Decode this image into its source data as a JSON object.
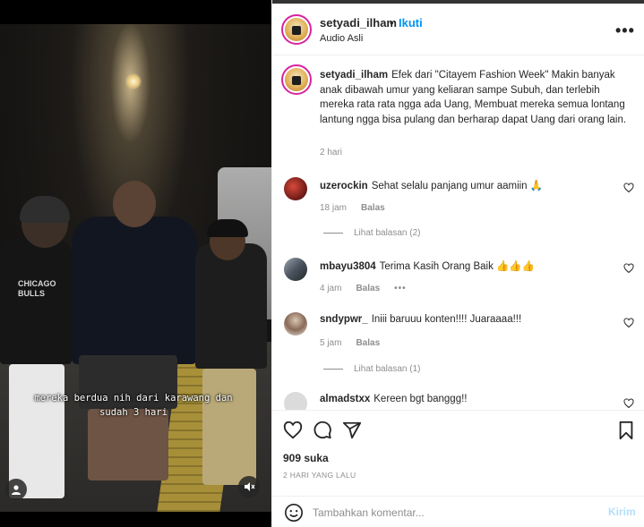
{
  "video": {
    "caption_line1": "mereka berdua nih dari karawang dan",
    "caption_line2": "sudah 3 hari",
    "shirt_logo": "CHICAGO BULLS",
    "icons": {
      "user_tag": "user-icon",
      "mute": "speaker-muted-icon"
    }
  },
  "post": {
    "username": "setyadi_ilham",
    "separator": "•",
    "follow_label": "Ikuti",
    "audio_label": "Audio Asli",
    "more_label": "•••",
    "caption": "Efek dari \"Citayem Fashion Week\" Makin banyak anak dibawah umur yang keliaran sampe Subuh, dan terlebih mereka rata rata ngga ada Uang, Membuat mereka semua lontang lantung ngga bisa pulang dan berharap dapat Uang dari orang lain.",
    "caption_time": "2 hari"
  },
  "comments": [
    {
      "username": "uzerockin",
      "text": "Sehat selalu panjang umur aamiin 🙏",
      "time": "18 jam",
      "reply_label": "Balas",
      "view_replies": "Lihat balasan (2)"
    },
    {
      "username": "mbayu3804",
      "text": "Terima Kasih Orang Baik 👍👍👍",
      "time": "4 jam",
      "reply_label": "Balas",
      "more": "•••"
    },
    {
      "username": "sndypwr_",
      "text": "Iniii baruuu konten!!!! Juaraaaa!!!",
      "time": "5 jam",
      "reply_label": "Balas",
      "view_replies": "Lihat balasan (1)"
    },
    {
      "username": "almadstxx",
      "text": "Kereen bgt banggg!!"
    }
  ],
  "actions": {
    "likes": "909 suka",
    "date": "2 HARI YANG LALU",
    "icons": [
      "heart-icon",
      "comment-icon",
      "share-icon",
      "bookmark-icon"
    ]
  },
  "add_comment": {
    "placeholder": "Tambahkan komentar...",
    "post_label": "Kirim"
  },
  "colors": {
    "link_blue": "#0095f6",
    "muted": "#8e8e8e",
    "text": "#262626",
    "post_disabled": "#b2dffc"
  }
}
